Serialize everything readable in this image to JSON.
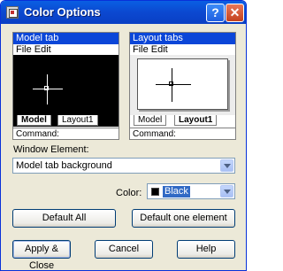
{
  "window": {
    "title": "Color Options",
    "help_label": "?",
    "close_label": "✕"
  },
  "preview_model": {
    "tab_label": "Model tab",
    "menu_label": "File  Edit",
    "tabs": [
      "Model",
      "Layout1"
    ],
    "command_text": "Command:"
  },
  "preview_layout": {
    "tab_label": "Layout tabs",
    "menu_label": "File  Edit",
    "tabs": [
      "Model",
      "Layout1"
    ],
    "command_text": "Command:"
  },
  "window_element": {
    "label": "Window Element:",
    "value": "Model tab background"
  },
  "color": {
    "label": "Color:",
    "value": "Black",
    "swatch_color": "#000000"
  },
  "buttons": {
    "default_all": "Default All",
    "default_one": "Default one element",
    "apply_close": "Apply & Close",
    "cancel": "Cancel",
    "help": "Help"
  },
  "colors": {
    "title_bar": "#0b48d0",
    "preview_tab_highlight": "#0b46d8",
    "dialog_background": "#ece9d8"
  }
}
